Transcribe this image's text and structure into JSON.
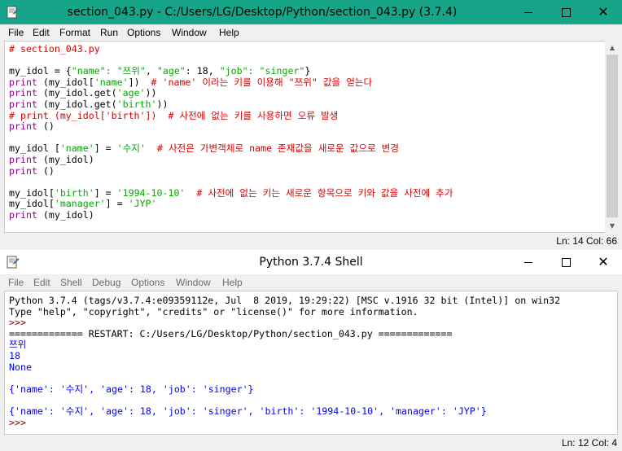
{
  "editor": {
    "title": "section_043.py - C:/Users/LG/Desktop/Python/section_043.py (3.7.4)",
    "menu": [
      "File",
      "Edit",
      "Format",
      "Run",
      "Options",
      "Window",
      "Help"
    ],
    "lines": [
      [
        {
          "t": "# section_043.py",
          "c": "comment"
        }
      ],
      [],
      [
        {
          "t": "my_idol = {",
          "c": "plain"
        },
        {
          "t": "\"name\": \"쯔위\"",
          "c": "string"
        },
        {
          "t": ", ",
          "c": "plain"
        },
        {
          "t": "\"age\"",
          "c": "string"
        },
        {
          "t": ": 18, ",
          "c": "plain"
        },
        {
          "t": "\"job\": \"singer\"",
          "c": "string"
        },
        {
          "t": "}",
          "c": "plain"
        }
      ],
      [
        {
          "t": "print",
          "c": "builtin"
        },
        {
          "t": " (my_idol[",
          "c": "plain"
        },
        {
          "t": "'name'",
          "c": "string"
        },
        {
          "t": "])  ",
          "c": "plain"
        },
        {
          "t": "# 'name' 이라는 키를 이용해 \"쯔위\" 값을 얻는다",
          "c": "comment"
        }
      ],
      [
        {
          "t": "print",
          "c": "builtin"
        },
        {
          "t": " (my_idol.get(",
          "c": "plain"
        },
        {
          "t": "'age'",
          "c": "string"
        },
        {
          "t": "))",
          "c": "plain"
        }
      ],
      [
        {
          "t": "print",
          "c": "builtin"
        },
        {
          "t": " (my_idol.get(",
          "c": "plain"
        },
        {
          "t": "'birth'",
          "c": "string"
        },
        {
          "t": "))",
          "c": "plain"
        }
      ],
      [
        {
          "t": "# print (my_idol['birth'])  # 사전에 없는 키를 사용하면 오류 발생",
          "c": "comment"
        }
      ],
      [
        {
          "t": "print",
          "c": "builtin"
        },
        {
          "t": " ()",
          "c": "plain"
        }
      ],
      [],
      [
        {
          "t": "my_idol [",
          "c": "plain"
        },
        {
          "t": "'name'",
          "c": "string"
        },
        {
          "t": "] = ",
          "c": "plain"
        },
        {
          "t": "'수지'",
          "c": "string"
        },
        {
          "t": "  ",
          "c": "plain"
        },
        {
          "t": "# 사전은 가변객체로 name 존재값을 새로운 값으로 변경",
          "c": "comment"
        }
      ],
      [
        {
          "t": "print",
          "c": "builtin"
        },
        {
          "t": " (my_idol)",
          "c": "plain"
        }
      ],
      [
        {
          "t": "print",
          "c": "builtin"
        },
        {
          "t": " ()",
          "c": "plain"
        }
      ],
      [],
      [
        {
          "t": "my_idol[",
          "c": "plain"
        },
        {
          "t": "'birth'",
          "c": "string"
        },
        {
          "t": "] = ",
          "c": "plain"
        },
        {
          "t": "'1994-10-10'",
          "c": "string"
        },
        {
          "t": "  ",
          "c": "plain"
        },
        {
          "t": "# 사전에 없는 키는 새로운 항목으로 키와 값을 사전에 추가",
          "c": "comment"
        }
      ],
      [
        {
          "t": "my_idol[",
          "c": "plain"
        },
        {
          "t": "'manager'",
          "c": "string"
        },
        {
          "t": "] = ",
          "c": "plain"
        },
        {
          "t": "'JYP'",
          "c": "string"
        }
      ],
      [
        {
          "t": "print",
          "c": "builtin"
        },
        {
          "t": " (my_idol)",
          "c": "plain"
        }
      ]
    ],
    "status": "Ln: 14  Col: 66"
  },
  "shell": {
    "title": "Python 3.7.4 Shell",
    "menu": [
      "File",
      "Edit",
      "Shell",
      "Debug",
      "Options",
      "Window",
      "Help"
    ],
    "lines": [
      [
        {
          "t": "Python 3.7.4 (tags/v3.7.4:e09359112e, Jul  8 2019, 19:29:22) [MSC v.1916 32 bit (Intel)] on win32",
          "c": "shell"
        }
      ],
      [
        {
          "t": "Type \"help\", \"copyright\", \"credits\" or \"license()\" for more information.",
          "c": "shell"
        }
      ],
      [
        {
          "t": ">>> ",
          "c": "prompt"
        }
      ],
      [
        {
          "t": "============= RESTART: C:/Users/LG/Desktop/Python/section_043.py =============",
          "c": "restart"
        }
      ],
      [
        {
          "t": "쯔위",
          "c": "out"
        }
      ],
      [
        {
          "t": "18",
          "c": "out"
        }
      ],
      [
        {
          "t": "None",
          "c": "out"
        }
      ],
      [],
      [
        {
          "t": "{'name': '수지', 'age': 18, 'job': 'singer'}",
          "c": "out"
        }
      ],
      [],
      [
        {
          "t": "{'name': '수지', 'age': 18, 'job': 'singer', 'birth': '1994-10-10', 'manager': 'JYP'}",
          "c": "out"
        }
      ],
      [
        {
          "t": ">>> ",
          "c": "prompt"
        }
      ]
    ],
    "status": "Ln: 12  Col: 4"
  },
  "colors": {
    "editor_titlebar": "#17a589",
    "comment": "#dd0000",
    "string": "#00aa00",
    "builtin": "#900090",
    "output": "#0000ff",
    "prompt": "#7f0000"
  }
}
